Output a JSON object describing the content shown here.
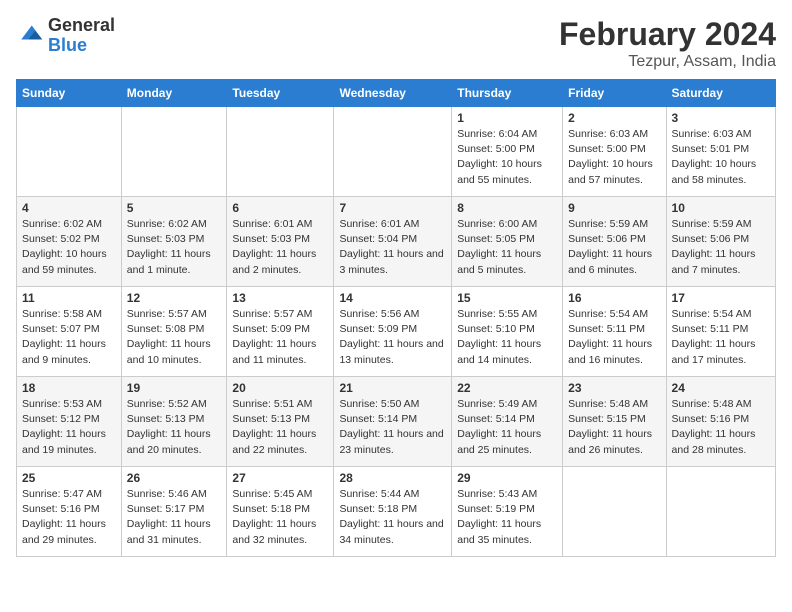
{
  "logo": {
    "line1": "General",
    "line2": "Blue"
  },
  "title": "February 2024",
  "subtitle": "Tezpur, Assam, India",
  "days_of_week": [
    "Sunday",
    "Monday",
    "Tuesday",
    "Wednesday",
    "Thursday",
    "Friday",
    "Saturday"
  ],
  "weeks": [
    [
      {
        "day": "",
        "info": ""
      },
      {
        "day": "",
        "info": ""
      },
      {
        "day": "",
        "info": ""
      },
      {
        "day": "",
        "info": ""
      },
      {
        "day": "1",
        "info": "Sunrise: 6:04 AM\nSunset: 5:00 PM\nDaylight: 10 hours and 55 minutes."
      },
      {
        "day": "2",
        "info": "Sunrise: 6:03 AM\nSunset: 5:00 PM\nDaylight: 10 hours and 57 minutes."
      },
      {
        "day": "3",
        "info": "Sunrise: 6:03 AM\nSunset: 5:01 PM\nDaylight: 10 hours and 58 minutes."
      }
    ],
    [
      {
        "day": "4",
        "info": "Sunrise: 6:02 AM\nSunset: 5:02 PM\nDaylight: 10 hours and 59 minutes."
      },
      {
        "day": "5",
        "info": "Sunrise: 6:02 AM\nSunset: 5:03 PM\nDaylight: 11 hours and 1 minute."
      },
      {
        "day": "6",
        "info": "Sunrise: 6:01 AM\nSunset: 5:03 PM\nDaylight: 11 hours and 2 minutes."
      },
      {
        "day": "7",
        "info": "Sunrise: 6:01 AM\nSunset: 5:04 PM\nDaylight: 11 hours and 3 minutes."
      },
      {
        "day": "8",
        "info": "Sunrise: 6:00 AM\nSunset: 5:05 PM\nDaylight: 11 hours and 5 minutes."
      },
      {
        "day": "9",
        "info": "Sunrise: 5:59 AM\nSunset: 5:06 PM\nDaylight: 11 hours and 6 minutes."
      },
      {
        "day": "10",
        "info": "Sunrise: 5:59 AM\nSunset: 5:06 PM\nDaylight: 11 hours and 7 minutes."
      }
    ],
    [
      {
        "day": "11",
        "info": "Sunrise: 5:58 AM\nSunset: 5:07 PM\nDaylight: 11 hours and 9 minutes."
      },
      {
        "day": "12",
        "info": "Sunrise: 5:57 AM\nSunset: 5:08 PM\nDaylight: 11 hours and 10 minutes."
      },
      {
        "day": "13",
        "info": "Sunrise: 5:57 AM\nSunset: 5:09 PM\nDaylight: 11 hours and 11 minutes."
      },
      {
        "day": "14",
        "info": "Sunrise: 5:56 AM\nSunset: 5:09 PM\nDaylight: 11 hours and 13 minutes."
      },
      {
        "day": "15",
        "info": "Sunrise: 5:55 AM\nSunset: 5:10 PM\nDaylight: 11 hours and 14 minutes."
      },
      {
        "day": "16",
        "info": "Sunrise: 5:54 AM\nSunset: 5:11 PM\nDaylight: 11 hours and 16 minutes."
      },
      {
        "day": "17",
        "info": "Sunrise: 5:54 AM\nSunset: 5:11 PM\nDaylight: 11 hours and 17 minutes."
      }
    ],
    [
      {
        "day": "18",
        "info": "Sunrise: 5:53 AM\nSunset: 5:12 PM\nDaylight: 11 hours and 19 minutes."
      },
      {
        "day": "19",
        "info": "Sunrise: 5:52 AM\nSunset: 5:13 PM\nDaylight: 11 hours and 20 minutes."
      },
      {
        "day": "20",
        "info": "Sunrise: 5:51 AM\nSunset: 5:13 PM\nDaylight: 11 hours and 22 minutes."
      },
      {
        "day": "21",
        "info": "Sunrise: 5:50 AM\nSunset: 5:14 PM\nDaylight: 11 hours and 23 minutes."
      },
      {
        "day": "22",
        "info": "Sunrise: 5:49 AM\nSunset: 5:14 PM\nDaylight: 11 hours and 25 minutes."
      },
      {
        "day": "23",
        "info": "Sunrise: 5:48 AM\nSunset: 5:15 PM\nDaylight: 11 hours and 26 minutes."
      },
      {
        "day": "24",
        "info": "Sunrise: 5:48 AM\nSunset: 5:16 PM\nDaylight: 11 hours and 28 minutes."
      }
    ],
    [
      {
        "day": "25",
        "info": "Sunrise: 5:47 AM\nSunset: 5:16 PM\nDaylight: 11 hours and 29 minutes."
      },
      {
        "day": "26",
        "info": "Sunrise: 5:46 AM\nSunset: 5:17 PM\nDaylight: 11 hours and 31 minutes."
      },
      {
        "day": "27",
        "info": "Sunrise: 5:45 AM\nSunset: 5:18 PM\nDaylight: 11 hours and 32 minutes."
      },
      {
        "day": "28",
        "info": "Sunrise: 5:44 AM\nSunset: 5:18 PM\nDaylight: 11 hours and 34 minutes."
      },
      {
        "day": "29",
        "info": "Sunrise: 5:43 AM\nSunset: 5:19 PM\nDaylight: 11 hours and 35 minutes."
      },
      {
        "day": "",
        "info": ""
      },
      {
        "day": "",
        "info": ""
      }
    ]
  ]
}
